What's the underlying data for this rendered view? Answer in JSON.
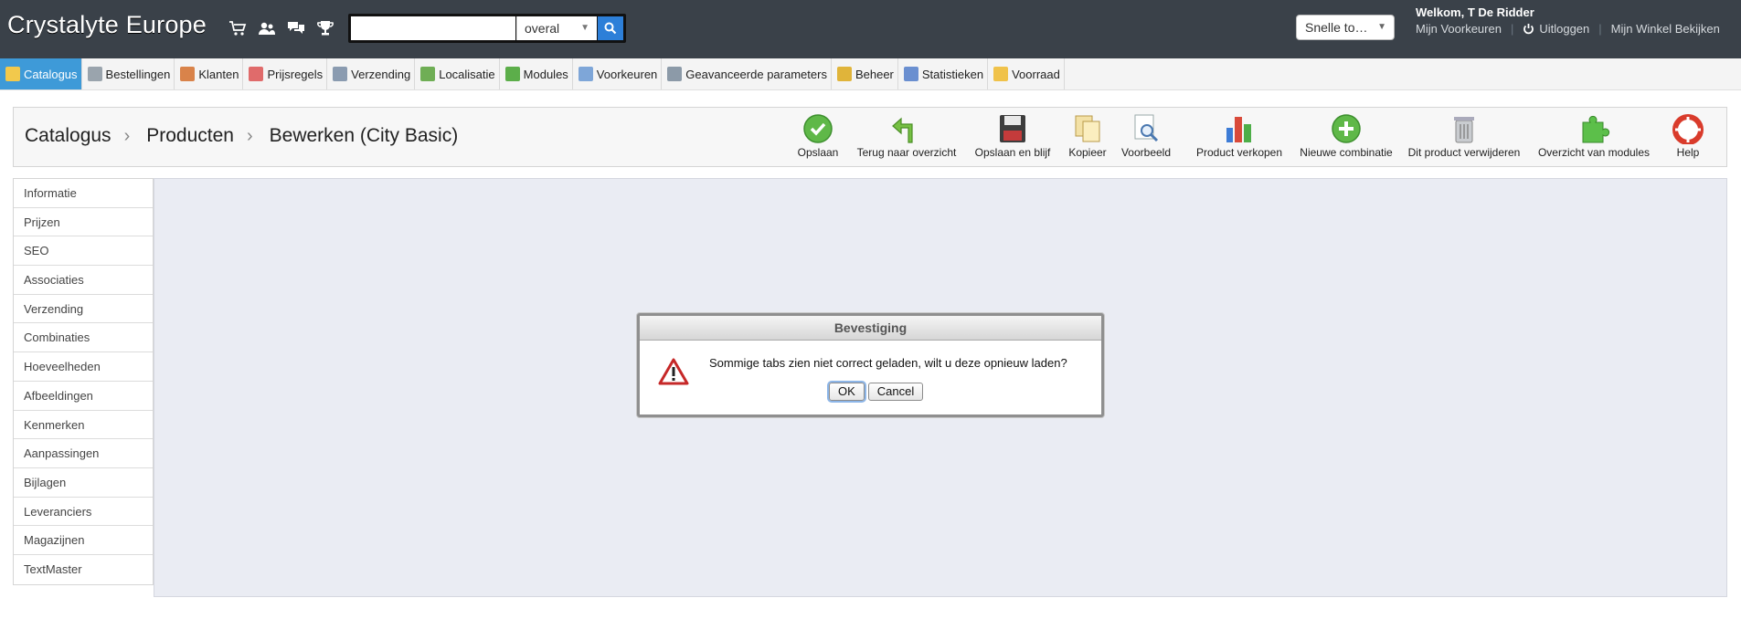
{
  "header": {
    "brand": "Crystalyte Europe",
    "quick_icons": [
      "cart-icon",
      "customers-icon",
      "messages-icon",
      "trophy-icon"
    ],
    "search": {
      "value": "",
      "placeholder": "",
      "scope": "overal"
    },
    "quick_access": "Snelle to…",
    "welcome": "Welkom, T De Ridder",
    "links": {
      "preferences": "Mijn Voorkeuren",
      "logout": "Uitloggen",
      "view_shop": "Mijn Winkel Bekijken"
    }
  },
  "menu": [
    {
      "label": "Catalogus",
      "icon": "folder-icon",
      "color": "#f2c94c",
      "active": true
    },
    {
      "label": "Bestellingen",
      "icon": "cart-icon",
      "color": "#9aa4ad"
    },
    {
      "label": "Klanten",
      "icon": "user-icon",
      "color": "#d9834a"
    },
    {
      "label": "Prijsregels",
      "icon": "price-rules-icon",
      "color": "#e06b6b"
    },
    {
      "label": "Verzending",
      "icon": "truck-icon",
      "color": "#8a9bb0"
    },
    {
      "label": "Localisatie",
      "icon": "globe-icon",
      "color": "#6fae55"
    },
    {
      "label": "Modules",
      "icon": "puzzle-icon",
      "color": "#5cae4a"
    },
    {
      "label": "Voorkeuren",
      "icon": "preferences-icon",
      "color": "#7ea6d8"
    },
    {
      "label": "Geavanceerde parameters",
      "icon": "wrench-icon",
      "color": "#8c9aa8"
    },
    {
      "label": "Beheer",
      "icon": "key-icon",
      "color": "#e0b43a"
    },
    {
      "label": "Statistieken",
      "icon": "stats-icon",
      "color": "#6a8fd0"
    },
    {
      "label": "Voorraad",
      "icon": "stock-icon",
      "color": "#f0c24a"
    }
  ],
  "breadcrumb": [
    "Catalogus",
    "Producten",
    "Bewerken (City Basic)"
  ],
  "toolbar": [
    {
      "label": "Opslaan",
      "icon": "save-check-icon"
    },
    {
      "label": "Terug naar overzicht",
      "icon": "back-arrow-icon"
    },
    {
      "label": "Opslaan en blijf",
      "icon": "floppy-disk-icon"
    },
    {
      "label": "Kopieer",
      "icon": "copy-icon"
    },
    {
      "label": "Voorbeeld",
      "icon": "preview-icon"
    },
    {
      "label": "Product verkopen",
      "icon": "sell-chart-icon"
    },
    {
      "label": "Nieuwe combinatie",
      "icon": "plus-circle-icon"
    },
    {
      "label": "Dit product verwijderen",
      "icon": "trash-icon"
    },
    {
      "label": "Overzicht van modules",
      "icon": "modules-puzzle-icon"
    },
    {
      "label": "Help",
      "icon": "lifebuoy-icon"
    }
  ],
  "tabs": [
    "Informatie",
    "Prijzen",
    "SEO",
    "Associaties",
    "Verzending",
    "Combinaties",
    "Hoeveelheden",
    "Afbeeldingen",
    "Kenmerken",
    "Aanpassingen",
    "Bijlagen",
    "Leveranciers",
    "Magazijnen",
    "TextMaster"
  ],
  "dialog": {
    "title": "Bevestiging",
    "message": "Sommige tabs zien niet correct geladen, wilt u deze opnieuw laden?",
    "ok": "OK",
    "cancel": "Cancel"
  },
  "colors": {
    "header_bg": "#3a4149",
    "active_menu": "#3e9ad8",
    "content_bg": "#eaecf3"
  }
}
